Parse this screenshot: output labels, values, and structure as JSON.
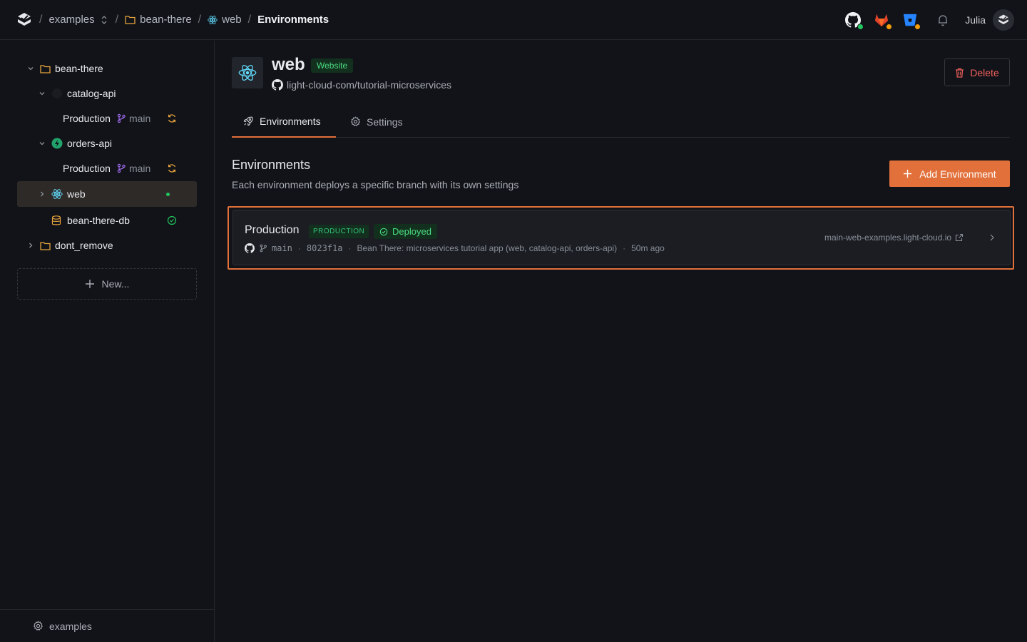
{
  "topbar": {
    "breadcrumbs": [
      {
        "label": "examples"
      },
      {
        "label": "bean-there"
      },
      {
        "label": "web"
      },
      {
        "label": "Environments"
      }
    ],
    "user_name": "Julia"
  },
  "sidebar": {
    "tree": {
      "project_bean_there": "bean-there",
      "catalog_api": "catalog-api",
      "catalog_env": "Production",
      "catalog_branch": "main",
      "orders_api": "orders-api",
      "orders_env": "Production",
      "orders_branch": "main",
      "web": "web",
      "database": "bean-there-db",
      "project_dont_remove": "dont_remove"
    },
    "new_label": "New...",
    "footer_label": "examples"
  },
  "service": {
    "name": "web",
    "badge": "Website",
    "repo": "light-cloud-com/tutorial-microservices",
    "delete_label": "Delete"
  },
  "tabs": [
    {
      "label": "Environments",
      "active": true
    },
    {
      "label": "Settings",
      "active": false
    }
  ],
  "environments_section": {
    "title": "Environments",
    "description": "Each environment deploys a specific branch with its own settings",
    "add_label": "Add Environment"
  },
  "environment_card": {
    "name": "Production",
    "tag": "PRODUCTION",
    "status": "Deployed",
    "branch": "main",
    "commit": "8023f1a",
    "commit_message": "Bean There: microservices tutorial app (web, catalog-api, orders-api)",
    "time": "50m ago",
    "url": "main-web-examples.light-cloud.io"
  },
  "colors": {
    "accent": "#e2703a",
    "success": "#4ade80",
    "danger": "#f0605d",
    "folder": "#e8a33d",
    "react": "#61dafb",
    "branch": "#a06cf0"
  }
}
